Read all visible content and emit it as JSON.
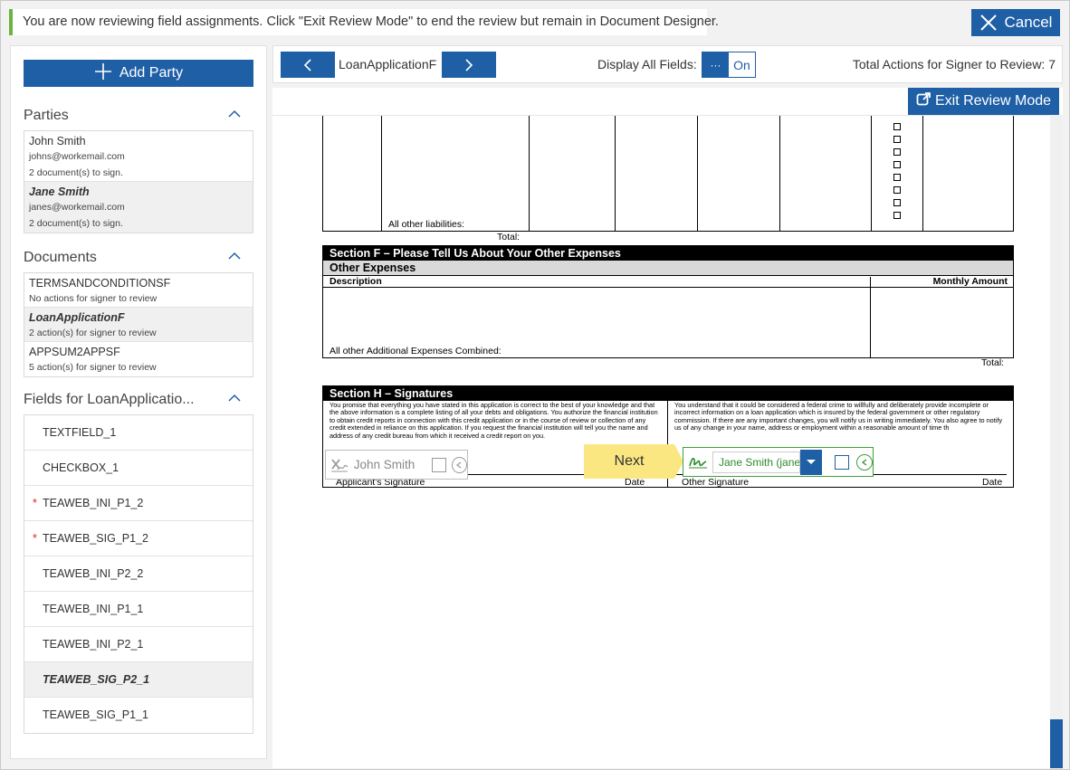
{
  "banner": {
    "message": "You are now reviewing field assignments. Click \"Exit Review Mode\" to end the review but remain in Document Designer.",
    "cancel_label": "Cancel"
  },
  "sidebar": {
    "add_party_label": "Add Party",
    "parties_heading": "Parties",
    "parties": [
      {
        "name": "John Smith",
        "email": "johns@workemail.com",
        "docs": "2 document(s) to sign."
      },
      {
        "name": "Jane Smith",
        "email": "janes@workemail.com",
        "docs": "2 document(s) to sign."
      }
    ],
    "documents_heading": "Documents",
    "documents": [
      {
        "name": "TERMSANDCONDITIONSF",
        "status": "No actions for signer to review"
      },
      {
        "name": "LoanApplicationF",
        "status": "2 action(s) for signer to review"
      },
      {
        "name": "APPSUM2APPSF",
        "status": "5 action(s) for signer to review"
      }
    ],
    "fields_heading": "Fields for LoanApplicatio...",
    "fields": [
      {
        "name": "TEXTFIELD_1",
        "required": false
      },
      {
        "name": "CHECKBOX_1",
        "required": false
      },
      {
        "name": "TEAWEB_INI_P1_2",
        "required": true
      },
      {
        "name": "TEAWEB_SIG_P1_2",
        "required": true
      },
      {
        "name": "TEAWEB_INI_P2_2",
        "required": false
      },
      {
        "name": "TEAWEB_INI_P1_1",
        "required": false
      },
      {
        "name": "TEAWEB_INI_P2_1",
        "required": false
      },
      {
        "name": "TEAWEB_SIG_P2_1",
        "required": false
      },
      {
        "name": "TEAWEB_SIG_P1_1",
        "required": false
      }
    ],
    "required_marker": "*"
  },
  "toolbar": {
    "document_name": "LoanApplicationF",
    "display_all_fields_label": "Display All Fields:",
    "toggle_off_label": "···",
    "toggle_on_label": "On",
    "total_actions": "Total Actions for Signer to Review: 7"
  },
  "exit_review_label": "Exit Review Mode",
  "form": {
    "all_other_liabilities": "All other liabilities:",
    "total_label": "Total:",
    "section_f_title": "Section F – Please Tell Us About Your Other Expenses",
    "other_expenses": "Other Expenses",
    "description": "Description",
    "monthly_amount": "Monthly Amount",
    "combined": "All other Additional Expenses Combined:",
    "section_h_title": "Section H – Signatures",
    "left_text": "You promise that everything you have stated in this application is correct to the best of your knowledge and that the above information is a complete listing of all your debts and obligations. You authorize the financial institution to obtain credit reports in connection with this credit application or in the course of review or collection of any credit extended in reliance on this application.  If you request the financial institution will tell you the name and address of any credit bureau from which it received a credit report on you.",
    "right_text": "You understand that it could be considered a federal crime to willfully and deliberately provide incomplete or incorrect information on a loan application which is insured by the federal government or other regulatory commission. If there are any important changes, you will notify us in writing immediately.  You also agree to notify us of any change in your name, address or employment within a reasonable amount of time th",
    "applicant_signature": "Applicant's Signature",
    "date": "Date",
    "other_signature": "Other Signature"
  },
  "widgets": {
    "john_name": "John Smith",
    "next_label": "Next",
    "jane_selected": "Jane Smith (janes"
  },
  "colors": {
    "primary": "#1f5fa6",
    "banner_accent": "#6cb33f",
    "next_highlight": "#fbe781",
    "active_signer": "#3ca03c",
    "required": "#d9262c"
  }
}
